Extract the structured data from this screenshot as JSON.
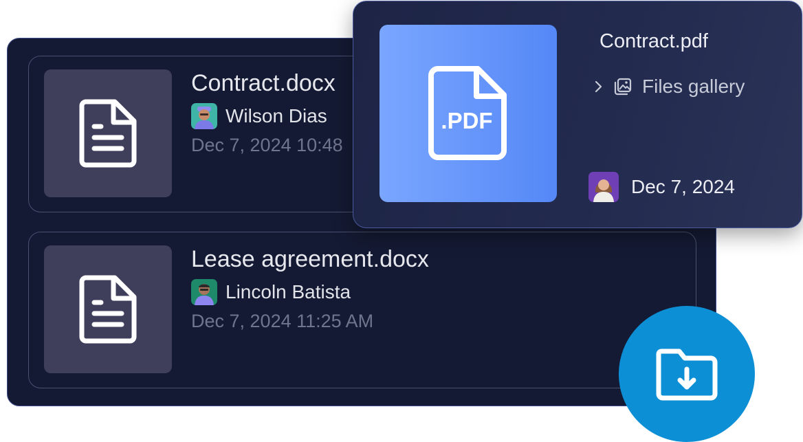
{
  "files": [
    {
      "title": "Contract.docx",
      "author": "Wilson Dias",
      "date": "Dec 7, 2024 10:48",
      "icon": "document-icon"
    },
    {
      "title": "Lease agreement.docx",
      "author": "Lincoln Batista",
      "date": "Dec 7, 2024 11:25 AM",
      "icon": "document-icon"
    }
  ],
  "preview": {
    "title": "Contract.pdf",
    "badge": ".PDF",
    "breadcrumb": "Files gallery",
    "date": "Dec 7, 2024",
    "icon": "pdf-file-icon"
  },
  "fab": {
    "icon": "folder-download-icon"
  },
  "colors": {
    "panel_bg": "#141a33",
    "card_border": "#4a5070",
    "thumb_bg": "#3f3f5c",
    "pdf_gradient_start": "#7aa6ff",
    "pdf_gradient_end": "#5588f7",
    "fab_bg": "#0d8fd6",
    "muted_text": "#70758e"
  }
}
